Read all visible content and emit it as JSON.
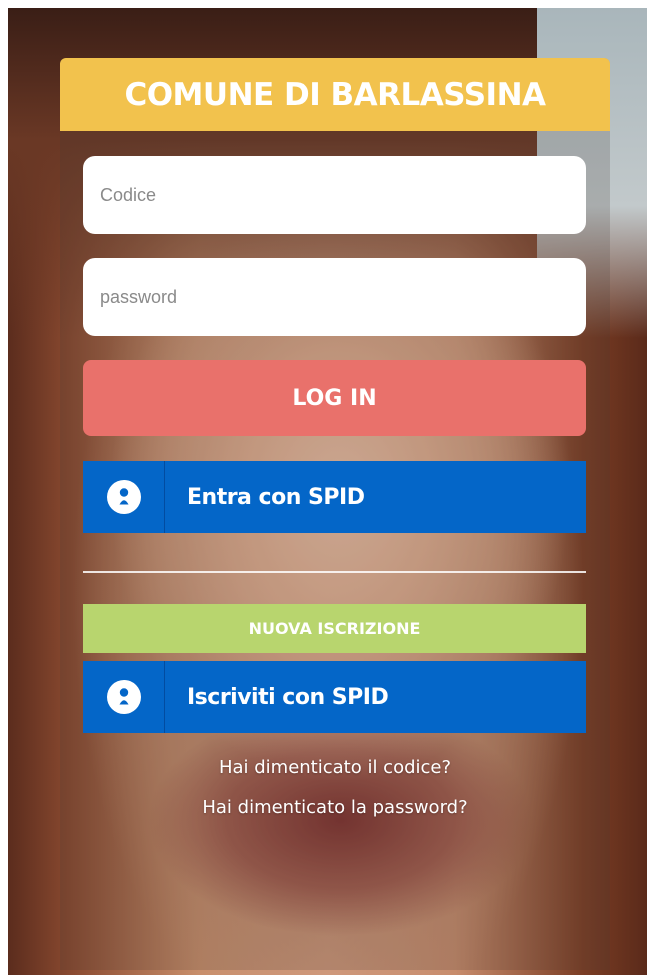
{
  "header": {
    "title": "COMUNE DI BARLASSINA"
  },
  "form": {
    "code_placeholder": "Codice",
    "code_value": "",
    "password_placeholder": "password",
    "password_value": "",
    "login_label": "LOG IN"
  },
  "spid_login": {
    "label": "Entra con SPID",
    "icon": "spid-user-icon"
  },
  "signup": {
    "label": "NUOVA ISCRIZIONE"
  },
  "spid_signup": {
    "label": "Iscriviti con SPID",
    "icon": "spid-user-icon"
  },
  "links": {
    "forgot_code": "Hai dimenticato il codice?",
    "forgot_password": "Hai dimenticato la password?"
  },
  "colors": {
    "header": "#f2c24d",
    "login": "#e9716b",
    "spid": "#0466c8",
    "signup": "#b8d56e"
  }
}
